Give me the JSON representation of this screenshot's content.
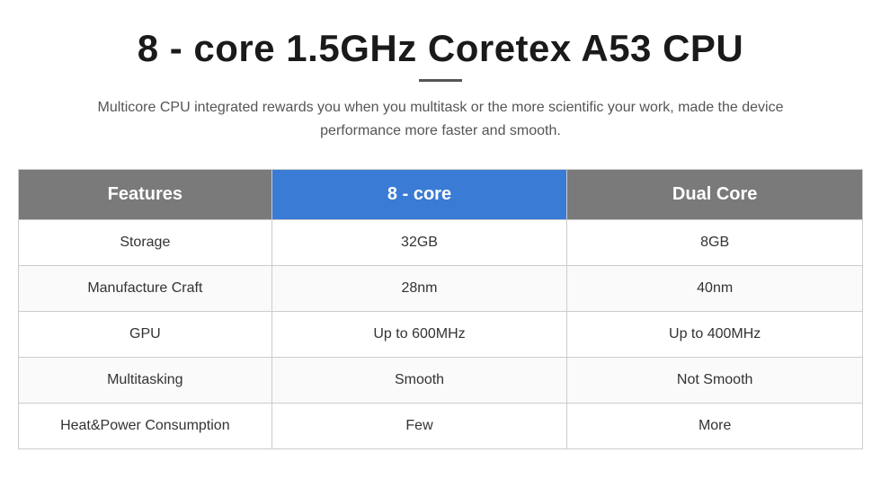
{
  "header": {
    "title": "8 - core 1.5GHz Coretex A53 CPU",
    "subtitle": "Multicore CPU integrated rewards you when you multitask or the more scientific your work, made the device performance more faster and smooth."
  },
  "table": {
    "columns": {
      "features_label": "Features",
      "col1_label": "8 - core",
      "col2_label": "Dual Core"
    },
    "rows": [
      {
        "feature": "Storage",
        "col1": "32GB",
        "col2": "8GB"
      },
      {
        "feature": "Manufacture Craft",
        "col1": "28nm",
        "col2": "40nm"
      },
      {
        "feature": "GPU",
        "col1": "Up to 600MHz",
        "col2": "Up to 400MHz"
      },
      {
        "feature": "Multitasking",
        "col1": "Smooth",
        "col2": "Not Smooth"
      },
      {
        "feature": "Heat&Power Consumption",
        "col1": "Few",
        "col2": "More"
      }
    ]
  }
}
